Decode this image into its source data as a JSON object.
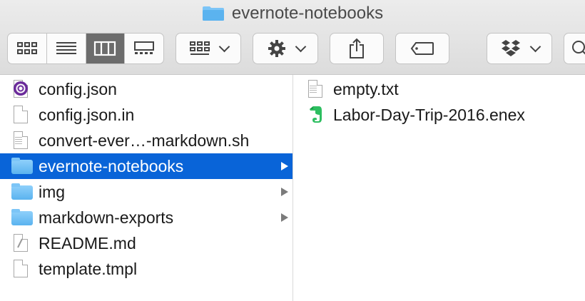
{
  "window": {
    "title": "evernote-notebooks"
  },
  "toolbar": {
    "view_modes": [
      "icon-view",
      "list-view",
      "column-view",
      "gallery-view"
    ],
    "active_view": "column-view",
    "buttons": [
      "group-by",
      "action-gear",
      "share",
      "edit-tags",
      "dropbox",
      "search"
    ]
  },
  "column1": {
    "items": [
      {
        "name": "config.json",
        "icon": "json-file-icon"
      },
      {
        "name": "config.json.in",
        "icon": "document-icon"
      },
      {
        "name": "convert-ever…-markdown.sh",
        "icon": "script-icon"
      },
      {
        "name": "evernote-notebooks",
        "icon": "folder-icon",
        "selected": true
      },
      {
        "name": "img",
        "icon": "folder-icon"
      },
      {
        "name": "markdown-exports",
        "icon": "folder-icon"
      },
      {
        "name": "README.md",
        "icon": "markdown-file-icon"
      },
      {
        "name": "template.tmpl",
        "icon": "document-icon"
      }
    ]
  },
  "column2": {
    "items": [
      {
        "name": "empty.txt",
        "icon": "text-file-icon"
      },
      {
        "name": "Labor-Day-Trip-2016.enex",
        "icon": "evernote-icon"
      }
    ]
  },
  "colors": {
    "selection": "#0964d8",
    "folder": "#6fbdf5",
    "evernote": "#2dbe60"
  }
}
